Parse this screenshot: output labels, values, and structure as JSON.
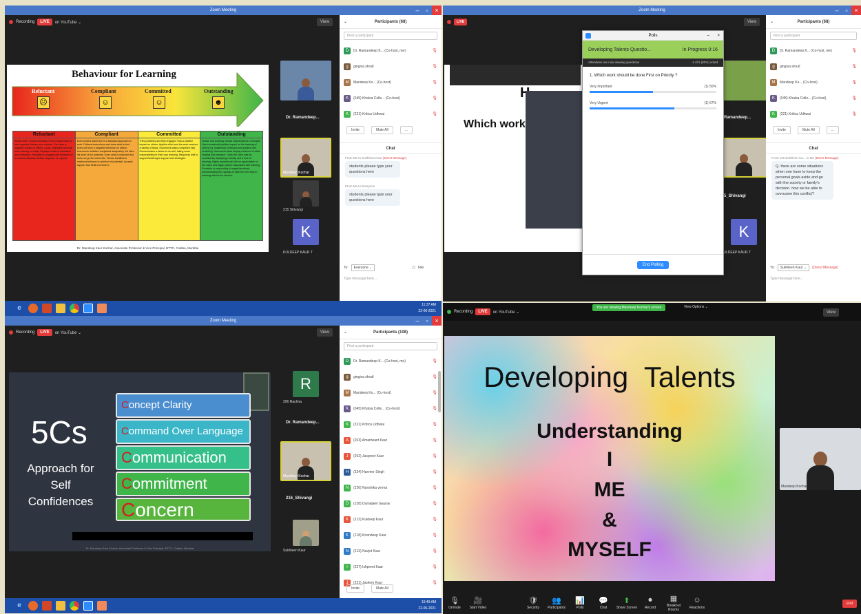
{
  "screens": {
    "tl": {
      "window_title": "Zoom Meeting",
      "recording_label": "Recording",
      "live_badge": "LIVE",
      "youtube_label": "on YouTube ⌄",
      "view_label": "View",
      "slide": {
        "title": "Behaviour for Learning",
        "arrow_stages": [
          "Reluctant",
          "Compliant",
          "Committed",
          "Outstanding"
        ],
        "columns": [
          {
            "head": "Reluctant",
            "color": "#e8261d",
            "text": "Avoids work, needs motivation to be brought back on task regularly. Makes poor choices. Can have a negative impact on others. Looks noticeably and has work missing or untidy. Displays a lack of aspiration and motivation. Reluctant to engage with feedback or to resolve setbacks, limited response to support."
          },
          {
            "head": "Compliant",
            "color": "#f4a93a",
            "text": "Does what is asked but in a standard approach to work. Follows instructions and does what is kind. Does not have a negative influence on others. Homework activities completed adequately but often fall short of full potential. Goes what is expected but does not go the extra mile. Shows insufficient resilience/reliance to achieve full potential. Accepts support and deals not seek it."
          },
          {
            "head": "Committed",
            "color": "#fbea3a",
            "text": "Tries positively and fully engaged. Has a positive impact on others. Applies effort and the work reaches a variety of tasks. Homework tasks completed fully. Demonstrates a desire to do well, taking some responsibility for their own learning. Responds well to support/challenges support and strategies."
          },
          {
            "head": "Outstanding",
            "color": "#3fb54a",
            "text": "Shows real learning, shows independence of thought. Has a sustained positive impact on the learning of others e.g. leadership in lessons and positive role modelling. Homework tasks display evidence of wider reading and research. Goes the extra mile by consistently displaying curiosity and a love of learning. Highly aspirational with an appreciation of the value and bigger picture associated with learning. Proactive in responding to targets/feedback, demonstrating the capacity to take the next step in learning without the teacher."
          }
        ],
        "footer": "Dr. Mandeep Kaur Kochar, Associate Professor & Vice Principal, BTTC, Colaba, Mumbai"
      },
      "videos": [
        {
          "name": "",
          "label": "Dr. Ramandeep..."
        },
        {
          "name": "Mandeep Kochar",
          "label": ""
        },
        {
          "name": "215 Shivangi",
          "label": ""
        },
        {
          "name": "KULDEEP KAUR T",
          "label": "",
          "letter": "K"
        }
      ],
      "participants_title": "Participants (68)",
      "search_placeholder": "Find a participant",
      "participants": [
        {
          "name": "Dr. Ramandeep K... (Co-host, me)",
          "initial": "D",
          "color": "#2e9a5a"
        },
        {
          "name": "gingiva shrutl",
          "initial": "g",
          "color": "#7a5a3a"
        },
        {
          "name": "Mandeep Ko... (Co-host)",
          "initial": "M",
          "color": "#a8744a"
        },
        {
          "name": "(045) Khalsa Colle... (Co-host)",
          "initial": "K",
          "color": "#6a5a8a"
        },
        {
          "name": "(221) Kritica Udhwai",
          "initial": "K",
          "color": "#3fb54a"
        }
      ],
      "invite_label": "Invite",
      "mute_all_label": "Mute All",
      "more_label": "...",
      "chat_title": "Chat",
      "messages": [
        {
          "from": "From Me to Sukhleen Kaur",
          "tag": "(Direct Message)",
          "text": "students please type your questions here"
        },
        {
          "from": "From Me to Everyone",
          "tag": "",
          "text": "students please type your questions here"
        }
      ],
      "to_label": "To:",
      "to_value": "Everyone ⌄",
      "file_label": "File",
      "type_placeholder": "Type message here..."
    },
    "tr": {
      "window_title": "Zoom Meeting",
      "view_label": "View",
      "slide_fragment": "Which work s",
      "slide_letter": "H",
      "poll_window_title": "Polls",
      "poll_header": "Developing Talents Questio...",
      "poll_status": "In Progress 0:16",
      "poll_sharing": "Attendees are now viewing questions",
      "poll_voted": "4 of 5 (80%) voted",
      "poll_question": "1. Which work should be done First on Priority ?",
      "poll_options": [
        {
          "label": "Very Important",
          "pct": "(1) 50%",
          "fraction": 0.5
        },
        {
          "label": "Very Urgent",
          "pct": "(1) 67%",
          "fraction": 0.67
        }
      ],
      "end_polling": "End Polling",
      "videos": [
        {
          "label": "Ramandeep..."
        },
        {
          "label": "Mandeep Kochar"
        },
        {
          "label": "5_Shivangi"
        },
        {
          "label": "KULDEEP KAUR T",
          "letter": "K"
        }
      ],
      "participants_title": "Participants (68)",
      "search_placeholder": "Find a participant",
      "participants": [
        {
          "name": "Dr. Ramandeep K... (Co-host, me)",
          "initial": "D",
          "color": "#2e9a5a"
        },
        {
          "name": "gingiva shrutl",
          "initial": "g",
          "color": "#7a5a3a"
        },
        {
          "name": "Mandeep Ko... (Co-host)",
          "initial": "M",
          "color": "#a8744a"
        },
        {
          "name": "(045) Khalsa Colle... (Co-host)",
          "initial": "K",
          "color": "#6a5a8a"
        },
        {
          "name": "(221) Kritica Udhwai",
          "initial": "K",
          "color": "#3fb54a"
        }
      ],
      "invite_label": "Invite",
      "mute_all_label": "Mute All",
      "more_label": "...",
      "chat_title": "Chat",
      "chat_meta": "From 119 Sukhleen Ka... to Me",
      "chat_meta_tag": "(Direct Message)",
      "chat_text": "Q. there are some situations when one have to keep the personal goals aside and go with the society or family's decision. how we be able to overcome this conflict?",
      "to_label": "To:",
      "to_value": "Sukhleen Kaur ⌄",
      "to_tag": "(Direct Message)",
      "type_placeholder": "Type message here..."
    },
    "bl": {
      "window_title": "Zoom Meeting",
      "recording_label": "Recording",
      "live_badge": "LIVE",
      "youtube_label": "on YouTube ⌄",
      "view_label": "View",
      "slide_big": "5Cs",
      "slide_sub": [
        "Approach for",
        "Self",
        "Confidences"
      ],
      "five_c": [
        {
          "first": "C",
          "rest": "oncept Clarity",
          "color": "#4a8ed0",
          "size": 15
        },
        {
          "first": "C",
          "rest": "ommand Over Language",
          "color": "#3ab6c8",
          "size": 15
        },
        {
          "first": "C",
          "rest": "ommunication",
          "color": "#35c08a",
          "size": 22
        },
        {
          "first": "C",
          "rest": "ommitment",
          "color": "#3fb54a",
          "size": 22
        },
        {
          "first": "C",
          "rest": "oncern",
          "color": "#57b43c",
          "size": 28
        }
      ],
      "slide_footer": "Dr. Mandeep Kaur Kochar, Associate Professor & Vice Principal, BTTC, Colaba, Mumbai",
      "videos": [
        {
          "name": "206 Rachna",
          "letter": "R"
        },
        {
          "name": "Dr. Ramandeep...",
          "label": "Dr. Ramandeep..."
        },
        {
          "name": "Mandeep Kochar"
        },
        {
          "name": "216_Shivangi",
          "label": "216_Shivangi"
        },
        {
          "name": "Sukhleen Kaur"
        }
      ],
      "participants_title": "Participants (108)",
      "search_placeholder": "Find a participant",
      "participants": [
        {
          "name": "Dr. Ramandeep K... (Co-host, me)",
          "initial": "D",
          "color": "#2e9a5a"
        },
        {
          "name": "gingiva shrutl",
          "initial": "g",
          "color": "#7a5a3a"
        },
        {
          "name": "Mandeep Ko... (Co-host)",
          "initial": "M",
          "color": "#a8744a"
        },
        {
          "name": "(045) Khalsa Colle... (Co-host)",
          "initial": "K",
          "color": "#6a5a8a"
        },
        {
          "name": "(221) Kritica Udhwai",
          "initial": "K",
          "color": "#3fb54a"
        },
        {
          "name": "(203) Amarbeant Kaur",
          "initial": "A",
          "color": "#e8553a"
        },
        {
          "name": "(202) Jaspreet Kaur",
          "initial": "J",
          "color": "#e8553a"
        },
        {
          "name": "(234) Harveer Singh",
          "initial": "H",
          "color": "#2e5a9a"
        },
        {
          "name": "(226) Nanshika verma",
          "initial": "N",
          "color": "#3fb54a"
        },
        {
          "name": "(228) Damaljeet Gaurav",
          "initial": "D",
          "color": "#3fb54a"
        },
        {
          "name": "(213) Kuldeep Kaur",
          "initial": "K",
          "color": "#e8553a"
        },
        {
          "name": "(218) Kirandeep Kaur",
          "initial": "K",
          "color": "#2e7ac8"
        },
        {
          "name": "(213) Navjot Kaur",
          "initial": "N",
          "color": "#2e7ac8"
        },
        {
          "name": "(227) Ishpreet Kaur",
          "initial": "I",
          "color": "#3fb54a"
        },
        {
          "name": "(221) Jasleen Kaur",
          "initial": "J",
          "color": "#e8553a"
        }
      ],
      "invite_label": "Invite",
      "mute_all_label": "Mute All"
    },
    "br": {
      "security_banner": "You are viewing Mandeep Kochar's screen",
      "view_options": "View Options ⌄",
      "recording_label": "Recording",
      "live_badge": "LIVE",
      "youtube_label": "on YouTube ⌄",
      "view_label": "View",
      "slide_title": "Developing  Talents",
      "slide_lines": [
        "Understanding",
        "I",
        "ME",
        "&",
        "MYSELF"
      ],
      "video_name": "Mandeep Kochar",
      "toolbar": [
        {
          "label": "Unmute",
          "icon": "🎙"
        },
        {
          "label": "Start Video",
          "icon": "🎥"
        },
        {
          "label": "Security",
          "icon": "🛡"
        },
        {
          "label": "Participants",
          "icon": "👥"
        },
        {
          "label": "Polls",
          "icon": "📊"
        },
        {
          "label": "Chat",
          "icon": "💬"
        },
        {
          "label": "Share Screen",
          "icon": "⬆"
        },
        {
          "label": "Record",
          "icon": "⏺"
        },
        {
          "label": "Breakout Rooms",
          "icon": "▦"
        },
        {
          "label": "Reactions",
          "icon": "☺"
        }
      ],
      "end_label": "End"
    }
  },
  "taskbars": {
    "top_time": "11:37 AM",
    "top_date": "22-06-2021",
    "bottom_time": "10:49 AM",
    "bottom_date": "22-06-2021"
  }
}
